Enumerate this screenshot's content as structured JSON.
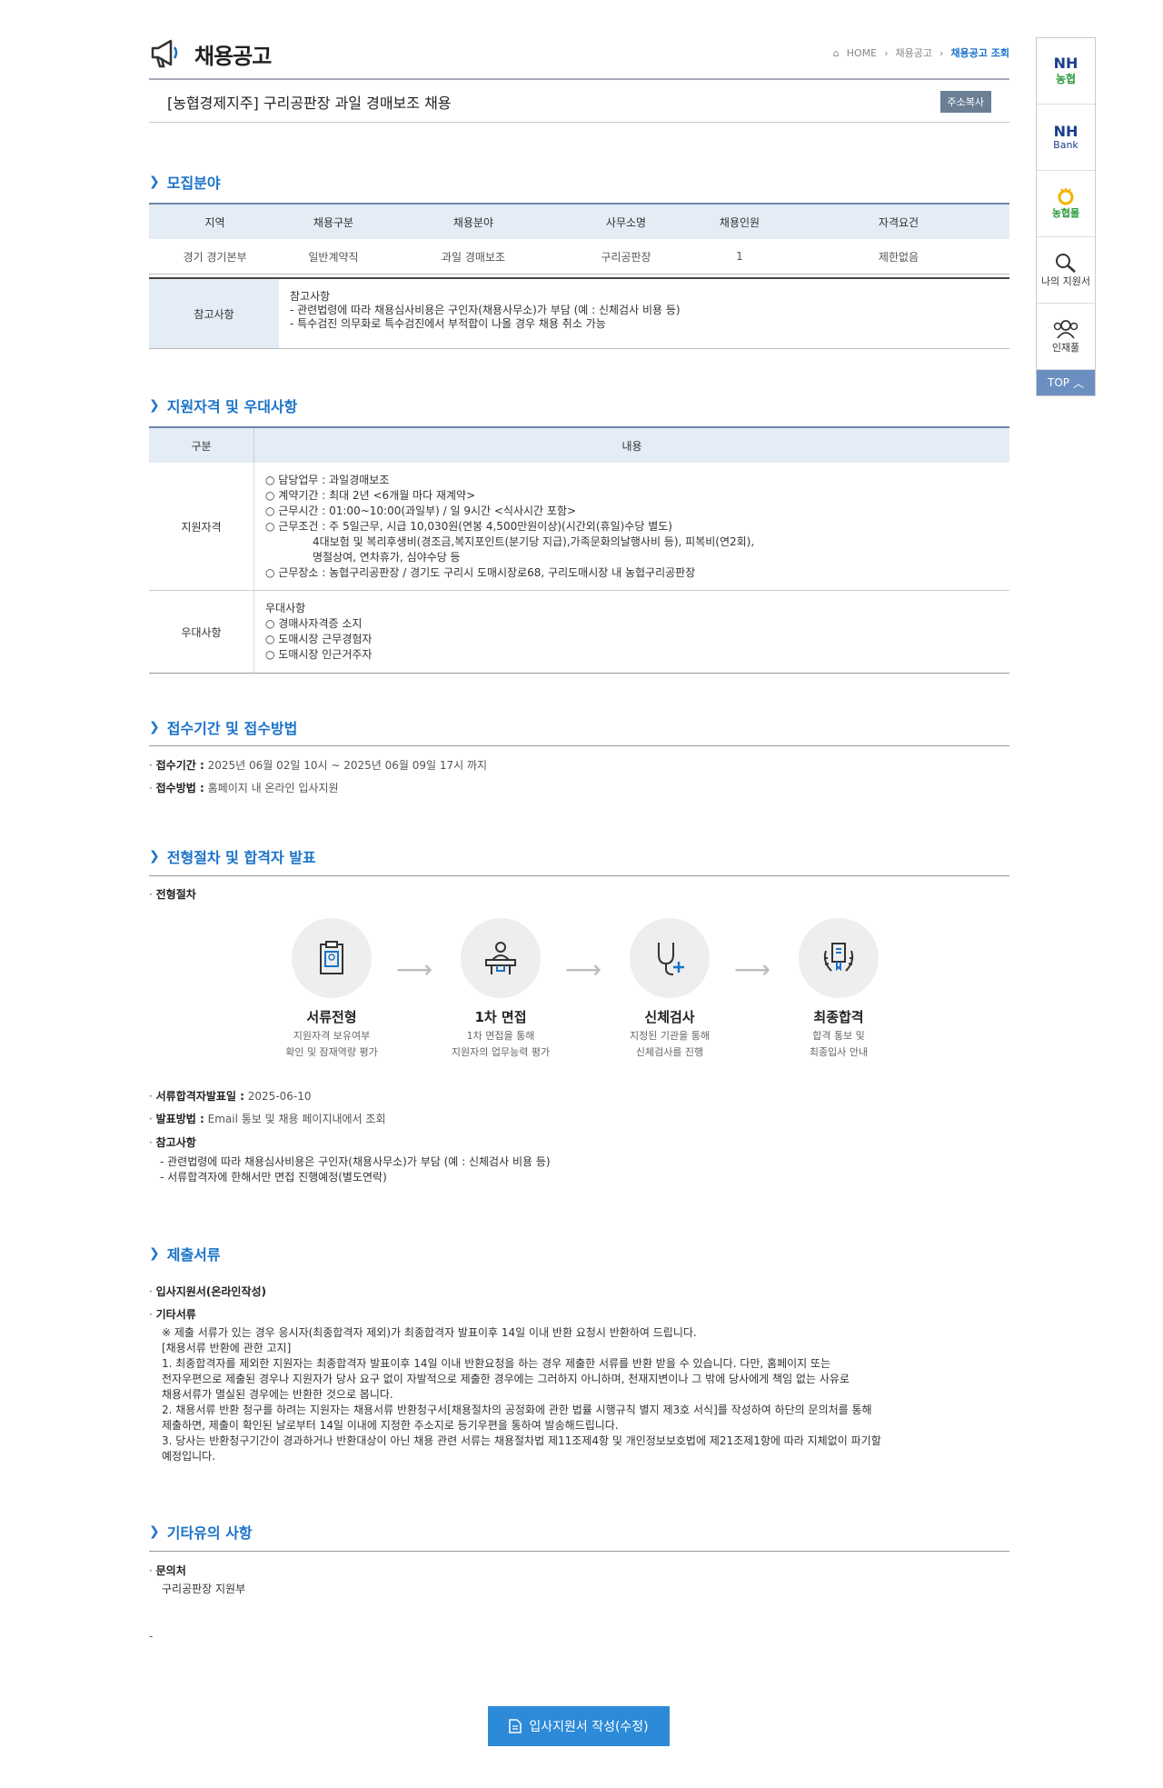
{
  "header": {
    "title": "채용공고",
    "breadcrumb": [
      "HOME",
      "채용공고",
      "채용공고 조회"
    ]
  },
  "job": {
    "title": "[농협경제지주] 구리공판장 과일 경매보조 채용",
    "copy_button": "주소복사"
  },
  "sections": {
    "recruit_field": "모집분야",
    "qualification": "지원자격 및 우대사항",
    "period": "접수기간 및 접수방법",
    "process": "전형절차 및 합격자 발표",
    "documents": "제출서류",
    "etc": "기타유의 사항"
  },
  "recruit_table": {
    "headers": [
      "지역",
      "채용구분",
      "채용분야",
      "사무소명",
      "채용인원",
      "자격요건"
    ],
    "row": [
      "경기 경기본부",
      "일반계약직",
      "과일 경매보조",
      "구리공판장",
      "1",
      "제한없음"
    ]
  },
  "note": {
    "label": "참고사항",
    "lines": [
      "참고사항",
      "- 관련법령에 따라 채용심사비용은 구인자(채용사무소)가 부담 (예 : 신체검사 비용 등)",
      "- 특수검진 의무화로 특수검진에서 부적합이 나올 경우 채용 취소 가능"
    ]
  },
  "qual_table": {
    "headers": [
      "구분",
      "내용"
    ],
    "rows": [
      {
        "label": "지원자격",
        "lines": [
          "○ 담당업무 : 과일경매보조",
          "○ 계약기간 : 최대 2년 <6개월 마다 재계약>",
          "○ 근무시간 : 01:00~10:00(과일부) / 일 9시간 <식사시간 포함>",
          "○ 근무조건 : 주 5일근무, 시급 10,030원(연봉 4,500만원이상)(시간외(휴일)수당 별도)",
          "4대보험 및 복리후생비(경조금,복지포인트(분기당 지급),가족문화의날행사비 등), 피복비(연2회),",
          "명절상여, 연차휴가, 심야수당 등",
          "○ 근무장소 : 농협구리공판장 / 경기도 구리시 도매시장로68, 구리도매시장 내 농협구리공판장"
        ]
      },
      {
        "label": "우대사항",
        "lines": [
          "우대사항",
          "○ 경매사자격증 소지",
          "○ 도매시장 근무경험자",
          "○ 도매시장 인근거주자"
        ]
      }
    ]
  },
  "period": {
    "period_label": "접수기간 :",
    "period_value": "2025년 06월 02일 10시 ~ 2025년 06월 09일 17시 까지",
    "method_label": "접수방법 :",
    "method_value": "홈페이지 내 온라인 입사지원"
  },
  "process": {
    "label": "전형절차",
    "steps": [
      {
        "title": "서류전형",
        "desc1": "지원자격 보유여부",
        "desc2": "확인 및 잠재역량 평가",
        "icon": "document-clipboard-icon"
      },
      {
        "title": "1차 면접",
        "desc1": "1차 면접을 통해",
        "desc2": "지원자의 업무능력 평가",
        "icon": "interview-podium-icon"
      },
      {
        "title": "신체검사",
        "desc1": "지정된 기관을 통해",
        "desc2": "신체검사를 진행",
        "icon": "stethoscope-icon"
      },
      {
        "title": "최종합격",
        "desc1": "합격 통보 및",
        "desc2": "최종입사 안내",
        "icon": "laurel-certificate-icon"
      }
    ],
    "announce_date_label": "서류합격자발표일 :",
    "announce_date_value": "2025-06-10",
    "announce_method_label": "발표방법 :",
    "announce_method_value": "Email 통보 및 채용 페이지내에서 조회",
    "note_label": "참고사항",
    "note_lines": [
      "- 관련법령에 따라 채용심사비용은 구인자(채용사무소)가 부담 (예 : 신체검사 비용 등)",
      "- 서류합격자에 한해서만 면접 진행예정(별도연락)"
    ]
  },
  "documents": {
    "item1": "입사지원서(온라인작성)",
    "item2": "기타서류",
    "lines": [
      "※ 제출 서류가 있는 경우 응시자(최종합격자 제외)가 최종합격자 발표이후 14일 이내 반환 요청시 반환하여 드립니다.",
      "[채용서류 반환에 관한 고지]",
      " 1. 최종합격자를 제외한 지원자는 최종합격자 발표이후 14일 이내 반환요청을 하는 경우 제출한 서류를 반환 받을 수 있습니다. 다만, 홈페이지 또는",
      "전자우편으로 제출된 경우나 지원자가 당사 요구 없이 자발적으로 제출한 경우에는 그러하지 아니하며, 천재지변이나 그 밖에 당사에게 책임 없는 사유로",
      "채용서류가 멸실된 경우에는 반환한 것으로 봅니다.",
      " 2. 채용서류 반환 청구를 하려는 지원자는 채용서류 반환청구서[채용절차의 공정화에 관한 법률 시행규칙 별지 제3호 서식]를 작성하여 하단의 문의처를 통해",
      "제출하면, 제출이 확인된 날로부터 14일 이내에 지정한 주소지로 등기우편을 통하여 발송해드립니다.",
      " 3. 당사는 반환청구기간이 경과하거나 반환대상이 아닌 채용 관련 서류는 채용절차법 제11조제4항 및 개인정보보호법에 제21조제1항에 따라 지체없이 파기할",
      "예정입니다."
    ]
  },
  "etc": {
    "contact_label": "문의처",
    "contact_value": "구리공판장 지원부",
    "trailing": "-"
  },
  "submit_button": "입사지원서 작성(수정)",
  "quick_menu": {
    "items": [
      {
        "line1": "NH",
        "line2": "농협"
      },
      {
        "line1": "NH",
        "line2": "Bank"
      },
      {
        "line1": "",
        "line2": "농협몰"
      },
      {
        "line1": "",
        "line2": "나의 지원서"
      },
      {
        "line1": "",
        "line2": "인재풀"
      }
    ],
    "top": "TOP"
  },
  "colors": {
    "accent": "#1a73c9",
    "table_header_bg": "#e4ecf5",
    "button_bg": "#2c8ad8",
    "quick_top_bg": "#6b8fc0",
    "nh_green": "#2a9a3a",
    "nh_blue": "#1b3d8f"
  }
}
